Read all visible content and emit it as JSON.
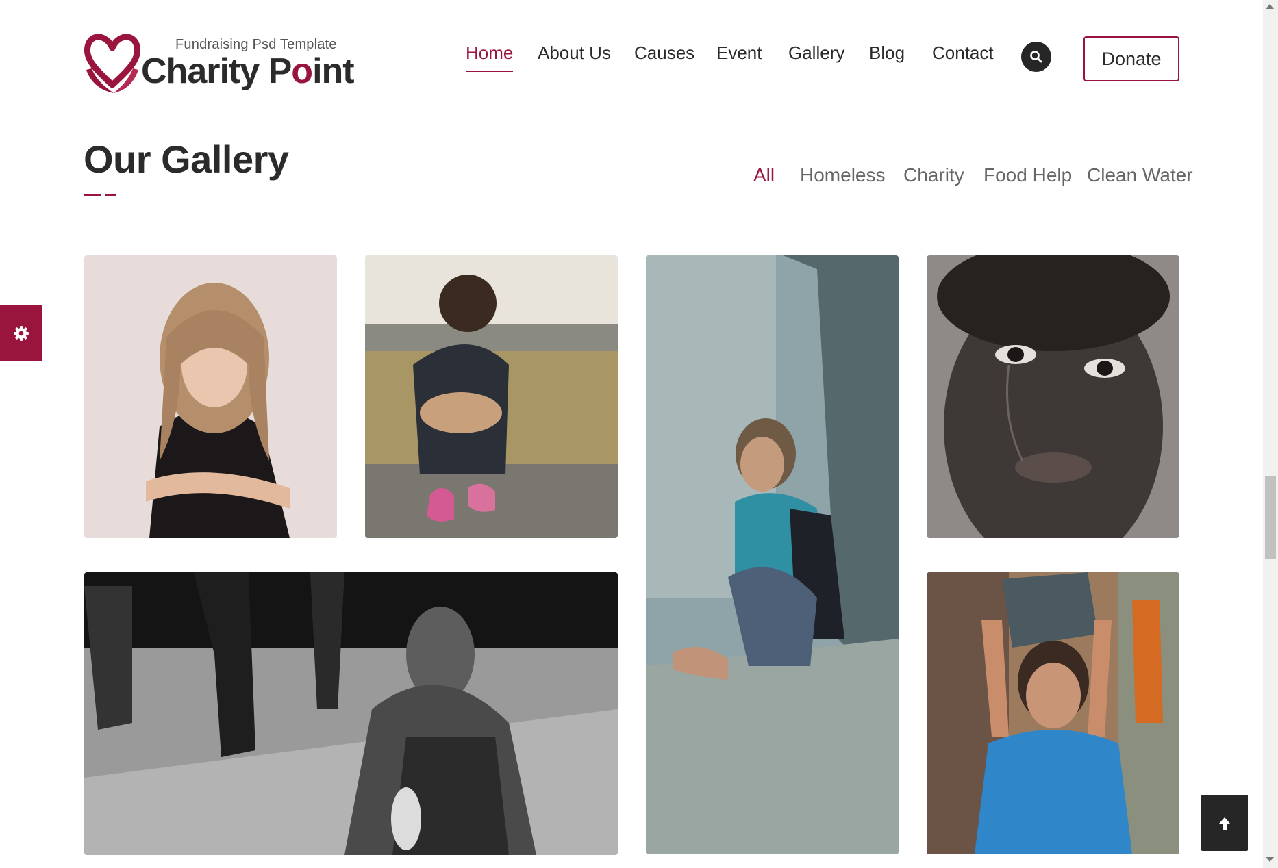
{
  "brand": {
    "tagline": "Fundraising Psd Template",
    "name_part1": "Charity P",
    "name_accent": "o",
    "name_part2": "int",
    "accent_color": "#99153e"
  },
  "nav": {
    "items": [
      {
        "label": "Home",
        "active": true
      },
      {
        "label": "About Us",
        "active": false
      },
      {
        "label": "Causes",
        "active": false
      },
      {
        "label": "Event",
        "active": false
      },
      {
        "label": "Gallery",
        "active": false
      },
      {
        "label": "Blog",
        "active": false
      },
      {
        "label": "Contact",
        "active": false
      }
    ],
    "search_icon": "search-icon",
    "donate_label": "Donate"
  },
  "gallery": {
    "title": "Our Gallery",
    "filters": [
      {
        "label": "All",
        "active": true
      },
      {
        "label": "Homeless",
        "active": false
      },
      {
        "label": "Charity",
        "active": false
      },
      {
        "label": "Food Help",
        "active": false
      },
      {
        "label": "Clean Water",
        "active": false
      }
    ],
    "photos": [
      {
        "subject": "blonde girl with arms crossed"
      },
      {
        "subject": "child sitting against wall in pink shoes"
      },
      {
        "subject": "boy sitting on curb by wall"
      },
      {
        "subject": "crying child close-up, monochrome"
      },
      {
        "subject": "woman sitting on street, black and white"
      },
      {
        "subject": "girl carrying stone on head"
      }
    ]
  },
  "widgets": {
    "settings_icon": "gear-icon",
    "back_to_top_icon": "arrow-up-icon"
  }
}
